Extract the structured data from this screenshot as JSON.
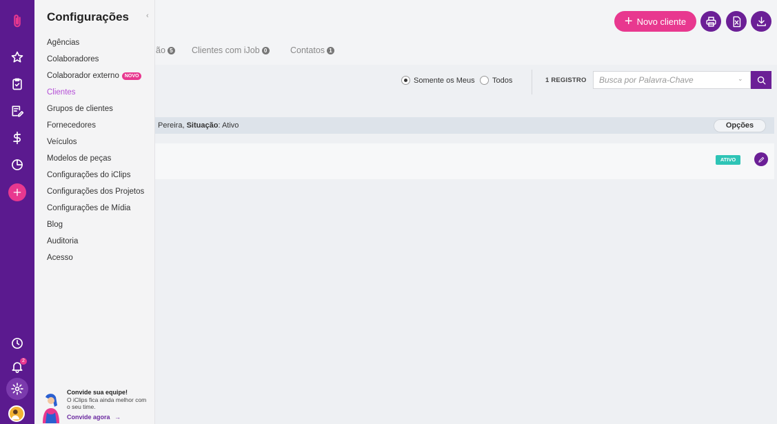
{
  "brand": {
    "accent": "#e8388f",
    "primary": "#6b1f96",
    "rail": "#5b1a8f"
  },
  "rail": {
    "icons": [
      "paperclip-logo-icon",
      "star-icon",
      "clipboard-check-icon",
      "edit-list-icon",
      "dollar-icon",
      "pie-chart-icon",
      "add-icon",
      "clock-icon",
      "bell-icon",
      "gear-icon",
      "avatar"
    ],
    "notifications_count": "2"
  },
  "panel": {
    "title": "Configurações",
    "collapse": "‹",
    "items": [
      {
        "label": "Agências"
      },
      {
        "label": "Colaboradores"
      },
      {
        "label": "Colaborador externo",
        "badge": "NOVO"
      },
      {
        "label": "Clientes",
        "active": true
      },
      {
        "label": "Grupos de clientes"
      },
      {
        "label": "Fornecedores"
      },
      {
        "label": "Veículos"
      },
      {
        "label": "Modelos de peças"
      },
      {
        "label": "Configurações do iClips"
      },
      {
        "label": "Configurações dos Projetos"
      },
      {
        "label": "Configurações de Mídia"
      },
      {
        "label": "Blog"
      },
      {
        "label": "Auditoria"
      },
      {
        "label": "Acesso"
      }
    ],
    "invite": {
      "title": "Convide sua equipe!",
      "text": "O iClips fica ainda melhor com o seu time.",
      "link": "Convide agora",
      "arrow": "→"
    }
  },
  "header": {
    "new_client": "Novo cliente",
    "plus": "+"
  },
  "tabs": [
    {
      "label": "ão",
      "count": "5"
    },
    {
      "label": "Clientes com iJob",
      "count": "0"
    },
    {
      "label": "Contatos",
      "count": "1"
    }
  ],
  "filters": {
    "radio_mine": "Somente os Meus",
    "radio_all": "Todos",
    "selected": "mine",
    "records": "1 REGISTRO",
    "search_placeholder": "Busca por Palavra-Chave",
    "caret": "⌄"
  },
  "filter_bar": {
    "text_prefix": "Pereira, ",
    "situacao_label": "Situação",
    "situacao_value": ": Ativo",
    "options": "Opções"
  },
  "row": {
    "status": "ATIVO"
  }
}
